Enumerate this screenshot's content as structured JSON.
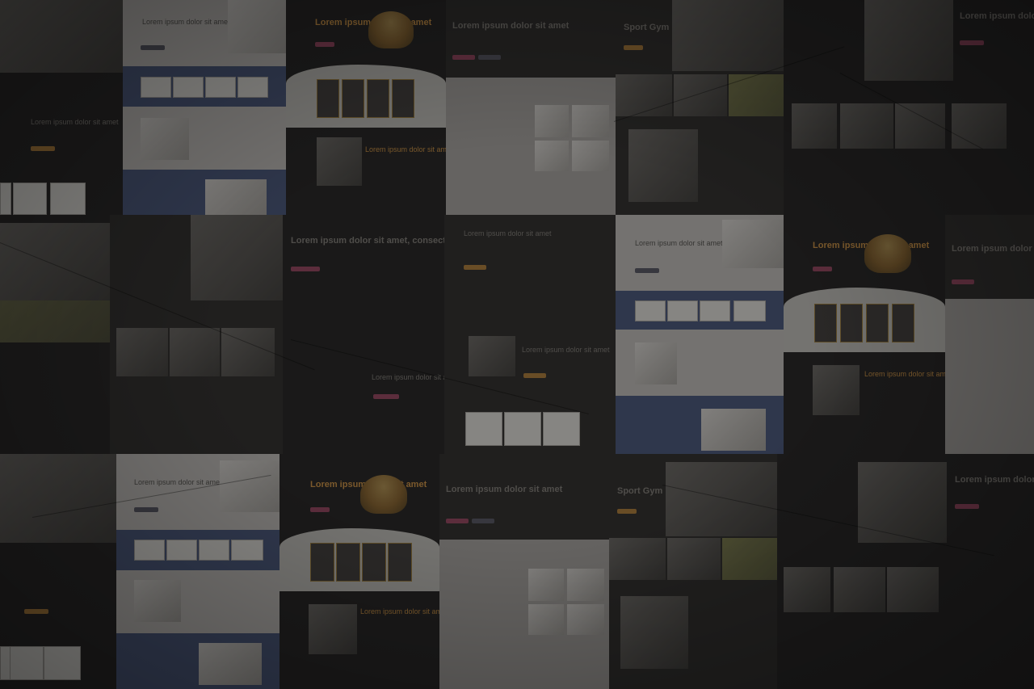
{
  "mosaic": {
    "lorem_headline": "Lorem ipsum dolor sit amet, consectetur adipiscing elit",
    "lorem_short": "Lorem ipsum dolor sit amet",
    "sport_gym_title": "Sport Gym"
  },
  "colors": {
    "background": "#1e1d1c",
    "accent_pink": "#8c3a55",
    "accent_orange": "#9b6a26",
    "medical_blue": "#3e4d70"
  },
  "icons": [
    "burger-image",
    "doctor-photo",
    "gym-photo"
  ]
}
